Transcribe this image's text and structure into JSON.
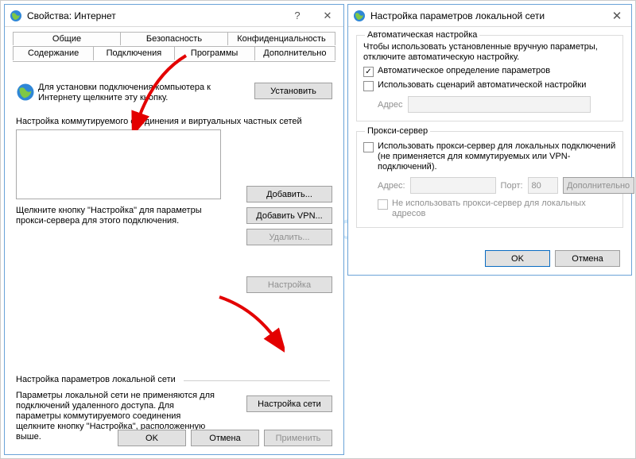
{
  "left": {
    "title": "Свойства: Интернет",
    "tabs_row1": {
      "general": "Общие",
      "security": "Безопасность",
      "privacy": "Конфиденциальность"
    },
    "tabs_row2": {
      "content": "Содержание",
      "connections": "Подключения",
      "programs": "Программы",
      "advanced": "Дополнительно"
    },
    "active_tab": "connections",
    "install_text": "Для установки подключения компьютера к Интернету щелкните эту кнопку.",
    "install_button": "Установить",
    "dialup_label": "Настройка коммутируемого соединения и виртуальных частных сетей",
    "add_button": "Добавить...",
    "add_vpn_button": "Добавить VPN...",
    "remove_button": "Удалить...",
    "settings_button": "Настройка",
    "settings_desc": "Щелкните кнопку \"Настройка\" для параметры прокси-сервера для этого подключения.",
    "lan_label": "Настройка параметров локальной сети",
    "lan_desc": "Параметры локальной сети не применяются для подключений удаленного доступа. Для параметры коммутируемого соединения щелкните кнопку \"Настройка\", расположенную выше.",
    "lan_button": "Настройка сети",
    "footer": {
      "ok": "OK",
      "cancel": "Отмена",
      "apply": "Применить"
    }
  },
  "right": {
    "title": "Настройка параметров локальной сети",
    "auto": {
      "legend": "Автоматическая настройка",
      "desc": "Чтобы использовать установленные вручную параметры, отключите автоматическую настройку.",
      "auto_detect": {
        "label": "Автоматическое определение параметров",
        "checked": true
      },
      "use_script": {
        "label": "Использовать сценарий автоматической настройки",
        "checked": false
      },
      "address_label": "Адрес",
      "address_value": ""
    },
    "proxy": {
      "legend": "Прокси-сервер",
      "use_proxy": {
        "label": "Использовать прокси-сервер для локальных подключений (не применяется для коммутируемых или VPN-подключений).",
        "checked": false
      },
      "address_label": "Адрес:",
      "address_value": "",
      "port_label": "Порт:",
      "port_value": "80",
      "more_button": "Дополнительно",
      "bypass_local": {
        "label": "Не использовать прокси-сервер для локальных адресов",
        "checked": false
      }
    },
    "footer": {
      "ok": "OK",
      "cancel": "Отмена"
    }
  },
  "watermark": "help-wifi.co"
}
